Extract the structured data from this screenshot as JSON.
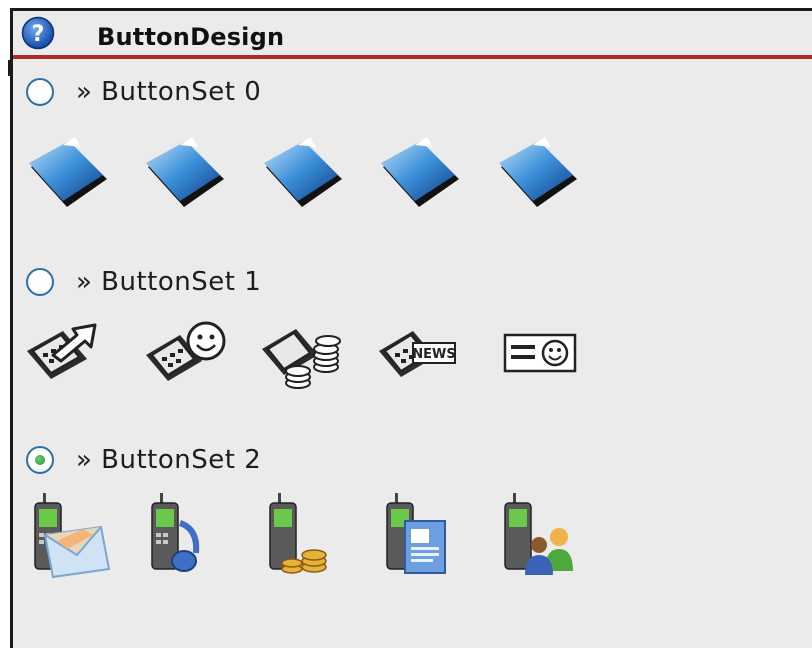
{
  "window": {
    "title": "ButtonDesign",
    "help_icon": "help-question-icon"
  },
  "sections": [
    {
      "label": "» ButtonSet 0",
      "selected": false,
      "icons": [
        "blue-folder-icon",
        "blue-folder-icon",
        "blue-folder-icon",
        "blue-folder-icon",
        "blue-folder-icon"
      ]
    },
    {
      "label": "» ButtonSet 1",
      "selected": false,
      "icons": [
        "phone-arrow-icon",
        "phone-smiley-icon",
        "phone-coins-icon",
        "phone-news-icon",
        "id-card-smiley-icon"
      ]
    },
    {
      "label": "» ButtonSet 2",
      "selected": true,
      "icons": [
        "mobile-mail-icon",
        "mobile-music-icon",
        "mobile-coins-icon",
        "mobile-document-icon",
        "mobile-contacts-icon"
      ]
    }
  ],
  "icon_text": {
    "news": "NEWS"
  },
  "colors": {
    "title_underline": "#b02a2a",
    "radio_border": "#2f6fa8",
    "radio_selected": "#1f8f2f",
    "panel_background": "#ebebeb"
  }
}
